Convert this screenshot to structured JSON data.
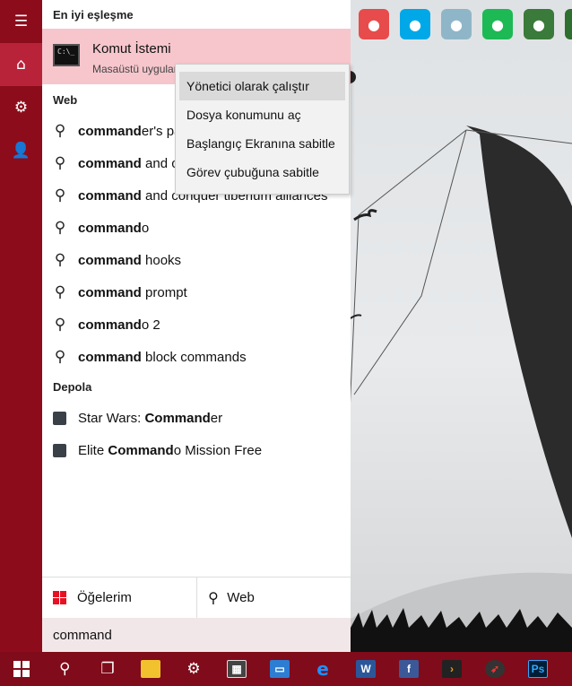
{
  "sidebar": {
    "menu_icon": "hamburger-icon",
    "items": [
      {
        "icon": "home-icon",
        "active": true
      },
      {
        "icon": "gear-icon",
        "active": false
      },
      {
        "icon": "user-feedback-icon",
        "active": false
      }
    ]
  },
  "panel": {
    "best_match_heading": "En iyi eşleşme",
    "best_match": {
      "title": "Komut İstemi",
      "subtitle": "Masaüstü uygulaması",
      "icon_text": "C:\\_"
    },
    "web_heading": "Web",
    "web_results": [
      {
        "bold": "command",
        "rest": "er's pa"
      },
      {
        "bold": "command",
        "rest": " and c"
      },
      {
        "bold": "command",
        "rest": " and conquer tiberium alliances"
      },
      {
        "bold": "command",
        "rest": "o"
      },
      {
        "bold": "command",
        "rest": " hooks"
      },
      {
        "bold": "command",
        "rest": " prompt"
      },
      {
        "bold": "command",
        "rest": "o 2"
      },
      {
        "bold": "command",
        "rest": " block commands"
      }
    ],
    "store_heading": "Depola",
    "store_results": [
      {
        "pre": "Star Wars: ",
        "bold": "Command",
        "rest": "er"
      },
      {
        "pre": "Elite ",
        "bold": "Command",
        "rest": "o Mission Free"
      }
    ],
    "tabs": {
      "apps": "Öğelerim",
      "web": "Web"
    },
    "search_value": "command"
  },
  "context_menu": [
    "Yönetici olarak çalıştır",
    "Dosya konumunu aç",
    "Başlangıç Ekranına sabitle",
    "Görev çubuğuna sabitle"
  ],
  "desktop_icons": [
    {
      "icon": "eraser-app-icon",
      "color": "#e84b4b"
    },
    {
      "icon": "skype-icon",
      "color": "#00a8e8"
    },
    {
      "icon": "notepad-icon",
      "color": "#8fb6c8"
    },
    {
      "icon": "spotify-icon",
      "color": "#1db954"
    },
    {
      "icon": "globe-app-icon",
      "color": "#3a7a3a"
    },
    {
      "icon": "app-icon",
      "color": "#2e6e2e"
    }
  ],
  "taskbar": {
    "items": [
      "windows-start-icon",
      "search-icon",
      "task-view-icon",
      "file-explorer-icon",
      "settings-icon",
      "calculator-icon",
      "remote-desktop-icon",
      "edge-icon",
      "word-icon",
      "facebook-icon",
      "plex-icon",
      "rocket-icon",
      "photoshop-icon"
    ],
    "labels": {
      "word": "W",
      "facebook": "f",
      "photoshop": "Ps"
    }
  },
  "colors": {
    "accent": "#8c0c1b",
    "accent_active": "#b9233a",
    "highlight": "#f6c6cc",
    "taskbar": "#800b1a"
  }
}
